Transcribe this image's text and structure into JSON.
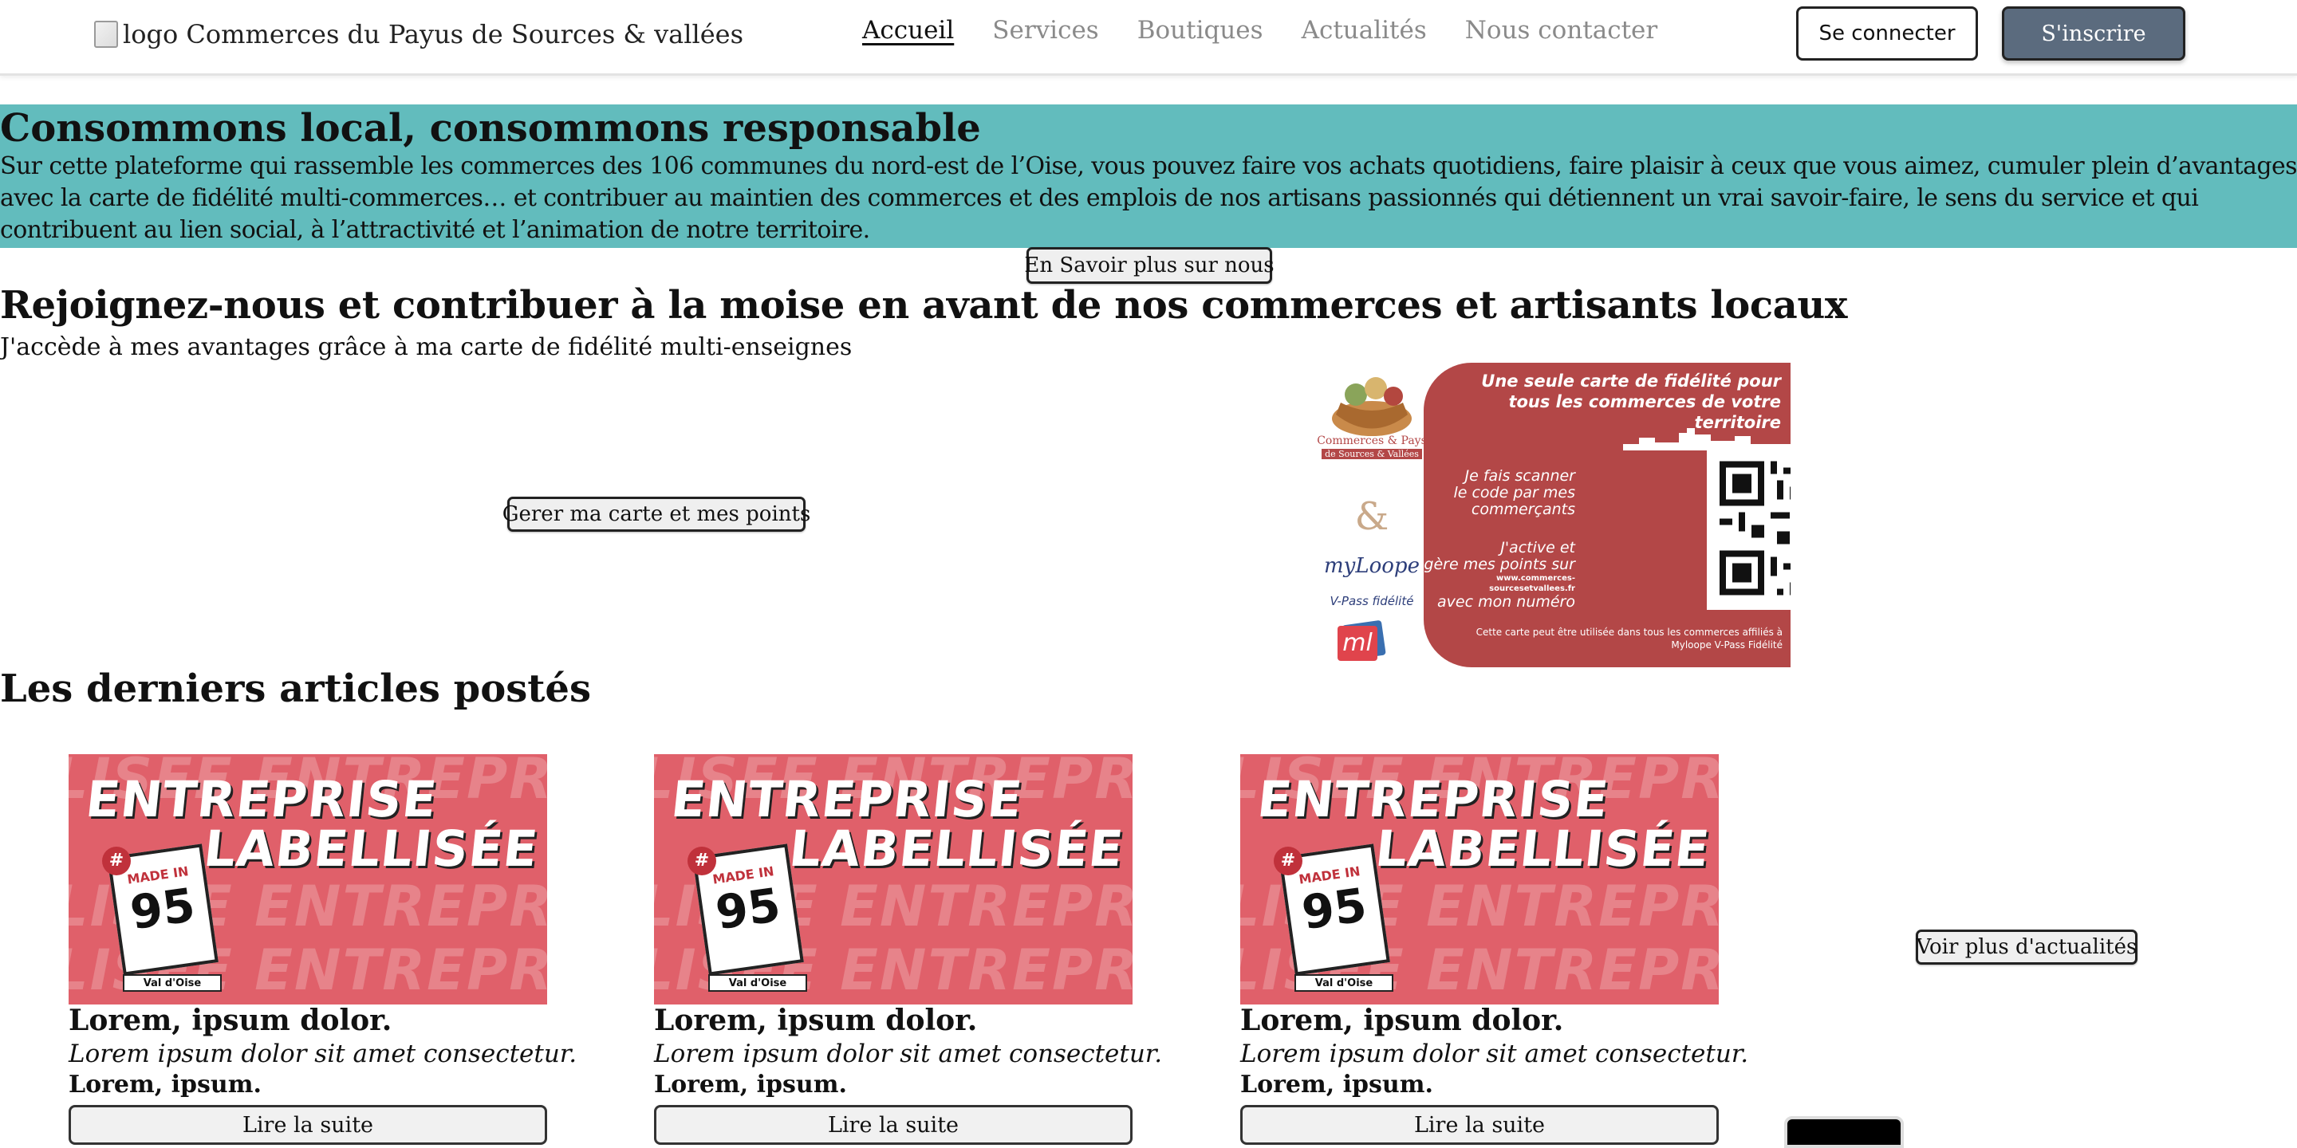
{
  "header": {
    "logo_alt": "logo",
    "site_name": "Commerces du Payus de Sources & vallées",
    "nav": [
      "Accueil",
      "Services",
      "Boutiques",
      "Actualités",
      "Nous contacter"
    ],
    "login_label": "Se connecter",
    "signup_label": "S'inscrire"
  },
  "hero": {
    "title": "Consommons local, consommons responsable",
    "text": "Sur cette plateforme qui rassemble les commerces des 106 communes du nord-est de l’Oise, vous pouvez faire vos achats quotidiens, faire plaisir à ceux que vous aimez, cumuler plein d’avantages avec la carte de fidélité multi-commerces… et contribuer au maintien des commerces et des emplois de nos artisans passionnés qui détiennent un vrai savoir-faire, le sens du service et qui contribuent au lien social, à l’attractivité et l’animation de notre territoire.",
    "more_button": "En Savoir plus sur nous"
  },
  "join": {
    "title": "Rejoignez-nous et contribuer à la moise en avant de nos commerces et artisants locaux",
    "subtitle": "J'accède à mes avantages grâce à ma carte de fidélité multi-enseignes",
    "manage_button": "Gerer ma carte et mes points",
    "card": {
      "headline_1": "Une seule carte de fidélité pour",
      "headline_2": "tous les commerces de votre territoire",
      "scan_1": "Je fais scanner",
      "scan_2": "le code par mes",
      "scan_3": "commerçants",
      "activate_1": "J'active et",
      "activate_2": "gère mes points sur",
      "activate_url": "www.commerces-sourcesetvallees.fr",
      "activate_3": "avec mon numéro",
      "footer_1": "Cette carte peut être utilisée dans tous les commerces affiliés à",
      "footer_2": "Myloope V-Pass Fidélité",
      "brand_1": "Commerces & Pays",
      "brand_2": "de Sources & Vallées",
      "amp": "&",
      "myloope": "myLoope",
      "vpass": "V-Pass fidélité",
      "ml": "ml",
      "accent_color": "#b34747"
    }
  },
  "articles": {
    "title": "Les derniers articles postés",
    "more_button": "Voir plus d'actualités",
    "items": [
      {
        "title": "Lorem, ipsum dolor.",
        "desc": "Lorem ipsum dolor sit amet consectetur.",
        "meta": "Lorem, ipsum.",
        "button": "Lire la suite",
        "img_line1": "ENTREPRISE",
        "img_line2": "LABELLISÉE",
        "badge_tag": "#",
        "badge_made": "MADE IN",
        "badge_num": "95",
        "badge_place": "Val d'Oise"
      },
      {
        "title": "Lorem, ipsum dolor.",
        "desc": "Lorem ipsum dolor sit amet consectetur.",
        "meta": "Lorem, ipsum.",
        "button": "Lire la suite",
        "img_line1": "ENTREPRISE",
        "img_line2": "LABELLISÉE",
        "badge_tag": "#",
        "badge_made": "MADE IN",
        "badge_num": "95",
        "badge_place": "Val d'Oise"
      },
      {
        "title": "Lorem, ipsum dolor.",
        "desc": "Lorem ipsum dolor sit amet consectetur.",
        "meta": "Lorem, ipsum.",
        "button": "Lire la suite",
        "img_line1": "ENTREPRISE",
        "img_line2": "LABELLISÉE",
        "badge_tag": "#",
        "badge_made": "MADE IN",
        "badge_num": "95",
        "badge_place": "Val d'Oise"
      }
    ],
    "image_bg_text": "LISÉE ENTREPRISE LABE",
    "image_bg_color": "#e0606a"
  },
  "colors": {
    "hero_bg": "#62bcbd",
    "signup_bg": "#5b6b7e"
  }
}
